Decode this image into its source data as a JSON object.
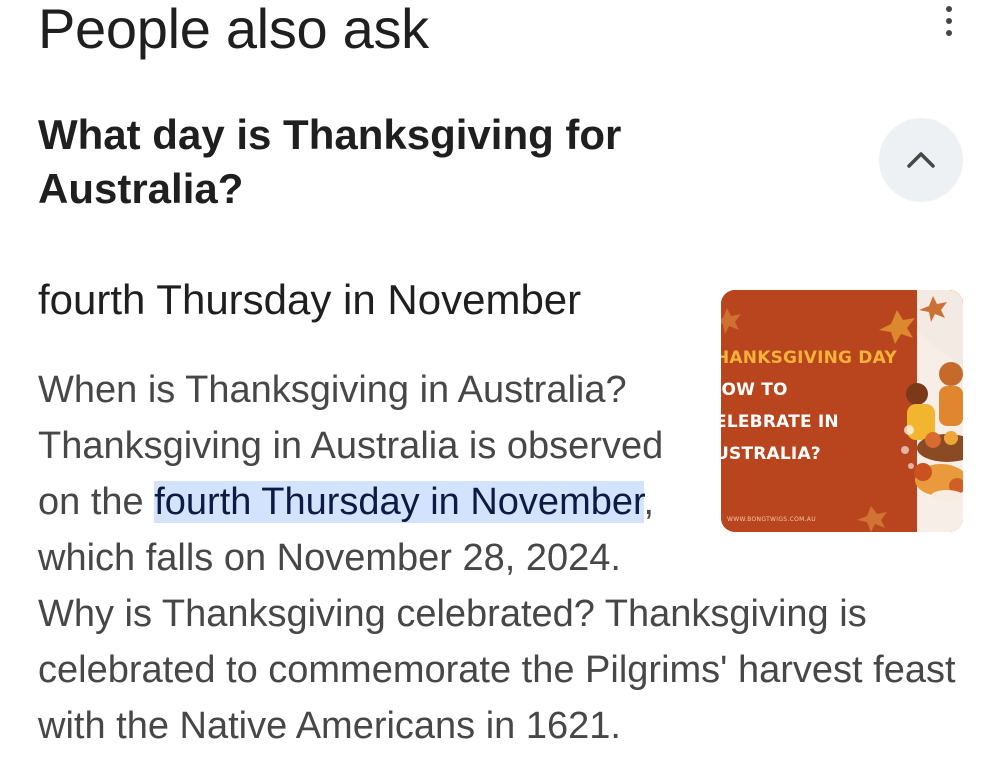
{
  "section": {
    "title": "People also ask"
  },
  "question": {
    "text": "What day is Thanksgiving for Australia?"
  },
  "answer": {
    "title": "fourth Thursday in November",
    "snippet_before": "When is Thanksgiving in Australia? Thanksgiving in Australia is observed on the ",
    "snippet_highlight": "fourth Thursday in November",
    "snippet_after": ", which falls on November 28, 2024. Why is Thanksgiving celebrated? Thanksgiving is celebrated to commemorate the Pilgrims' harvest feast with the Native Americans in 1621."
  },
  "thumbnail": {
    "line1": "HANKSGIVING DAY",
    "line2": "IOW TO",
    "line3": "ELEBRATE IN",
    "line4": "USTRALIA?",
    "url": "WWW.BONGTWIGS.COM.AU"
  },
  "colors": {
    "highlight": "#d3e3fd",
    "thumbnail_bg": "#b8451d",
    "accent_text": "#f6b238"
  },
  "icons": {
    "menu": "more-vert-icon",
    "collapse": "chevron-up-icon"
  }
}
